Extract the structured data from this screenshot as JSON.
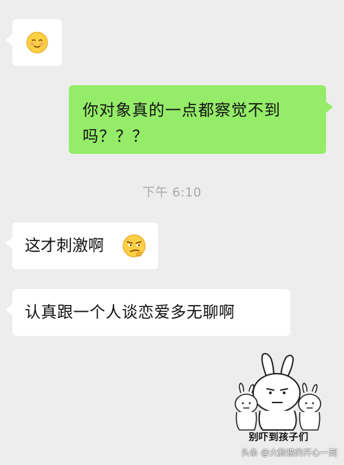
{
  "messages": [
    {
      "side": "left",
      "type": "emoji",
      "emoji": "smiling-blush-emoji"
    },
    {
      "side": "right",
      "type": "text",
      "text": "你对象真的一点都察觉不到吗？？？"
    },
    {
      "side": "left",
      "type": "text",
      "text": "这才刺激啊",
      "emoji": "smirk-emoji"
    },
    {
      "side": "left",
      "type": "text",
      "text": "认真跟一个人谈恋爱多无聊啊"
    }
  ],
  "timestamp": "下午 6:10",
  "sticker": {
    "caption": "别吓到孩子们",
    "icon": "rabbit-sticker"
  },
  "watermark": "头条 @大脸猫的开心一刻",
  "colors": {
    "background": "#ededed",
    "incoming_bubble": "#ffffff",
    "outgoing_bubble": "#95ec69",
    "timestamp_text": "#a9a9a9"
  }
}
